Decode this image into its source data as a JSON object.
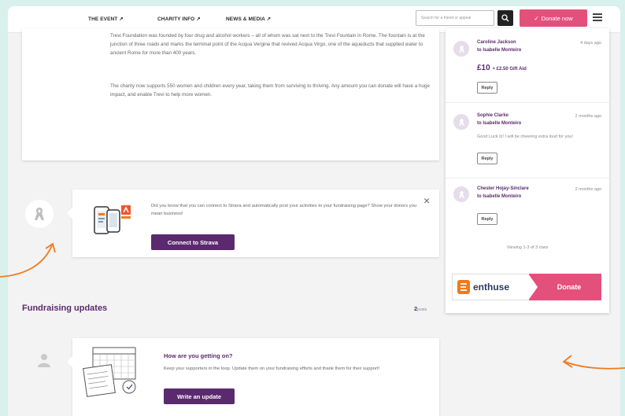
{
  "nav": {
    "event": "THE EVENT ↗",
    "charity": "CHARITY INFO ↗",
    "news": "NEWS & MEDIA ↗",
    "search_placeholder": "Search for a friend or appeal",
    "donate_now": "Donate now"
  },
  "story": {
    "para1": "Trevi Foundation was founded by four drug and alcohol workers – all of whom was sat next to the Trevi Fountain in Rome. The fountain is at the junction of three roads and marks the terminal point of the Acqua Vergine that revived Acqua Virgo, one of the aqueducts that supplied water to ancient Rome for more than 400 years.",
    "para2": "The charity now supports 550 women and children every year, taking them from surviving to thriving. Any amount you can donate will have a huge impact, and enable Trevi to help more women."
  },
  "strava": {
    "text": "Did you know that you can connect to Strava and automatically post your activities to your fundraising page? Show your donors you mean business!",
    "button": "Connect to Strava",
    "close": "×"
  },
  "updates": {
    "heading": "Fundraising updates",
    "count": "2",
    "count_unit": "posts",
    "card_title": "How are you getting on?",
    "card_text": "Keep your supporters in the loop. Update them on your fundraising efforts and thank them for their support!",
    "button": "Write an update"
  },
  "donations": [
    {
      "name": "Caroline Jackson",
      "to": "to Isabelle Monteiro",
      "time": "4 days ago",
      "amount": "£10",
      "gift_aid": "+ £2.50 Gift Aid",
      "reply": "Reply"
    },
    {
      "name": "Sophie Clarke",
      "to": "to Isabelle Monteiro",
      "time": "2 months ago",
      "message": "Good Luck Iz! I will be cheering extra loud for you!",
      "reply": "Reply"
    },
    {
      "name": "Chester Hojay-Sinclare",
      "to": "to Isabelle Monteiro",
      "time": "2 months ago",
      "reply": "Reply"
    }
  ],
  "viewing": "Viewing 1-3 of 3 rows",
  "enthuse": {
    "logo_text": "enthuse",
    "donate": "Donate"
  },
  "colors": {
    "brand_purple": "#5b2a6e",
    "accent_pink": "#e4507c",
    "enthuse_orange": "#f07a1c",
    "annotation_orange": "#f07a1c"
  }
}
